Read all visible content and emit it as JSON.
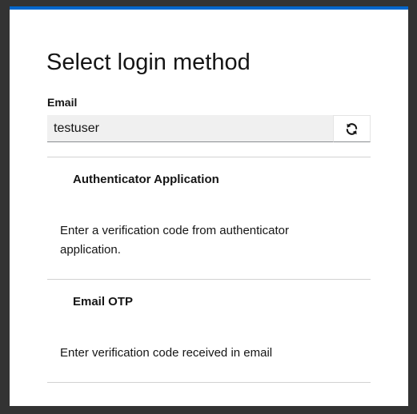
{
  "page": {
    "title": "Select login method",
    "accent_color": "#0066cc"
  },
  "username_field": {
    "label": "Email",
    "value": "testuser",
    "restart_icon": "refresh-icon"
  },
  "options": [
    {
      "title": "Authenticator Application",
      "description": "Enter a verification code from authenticator application."
    },
    {
      "title": "Email OTP",
      "description": "Enter verification code received in email"
    }
  ]
}
